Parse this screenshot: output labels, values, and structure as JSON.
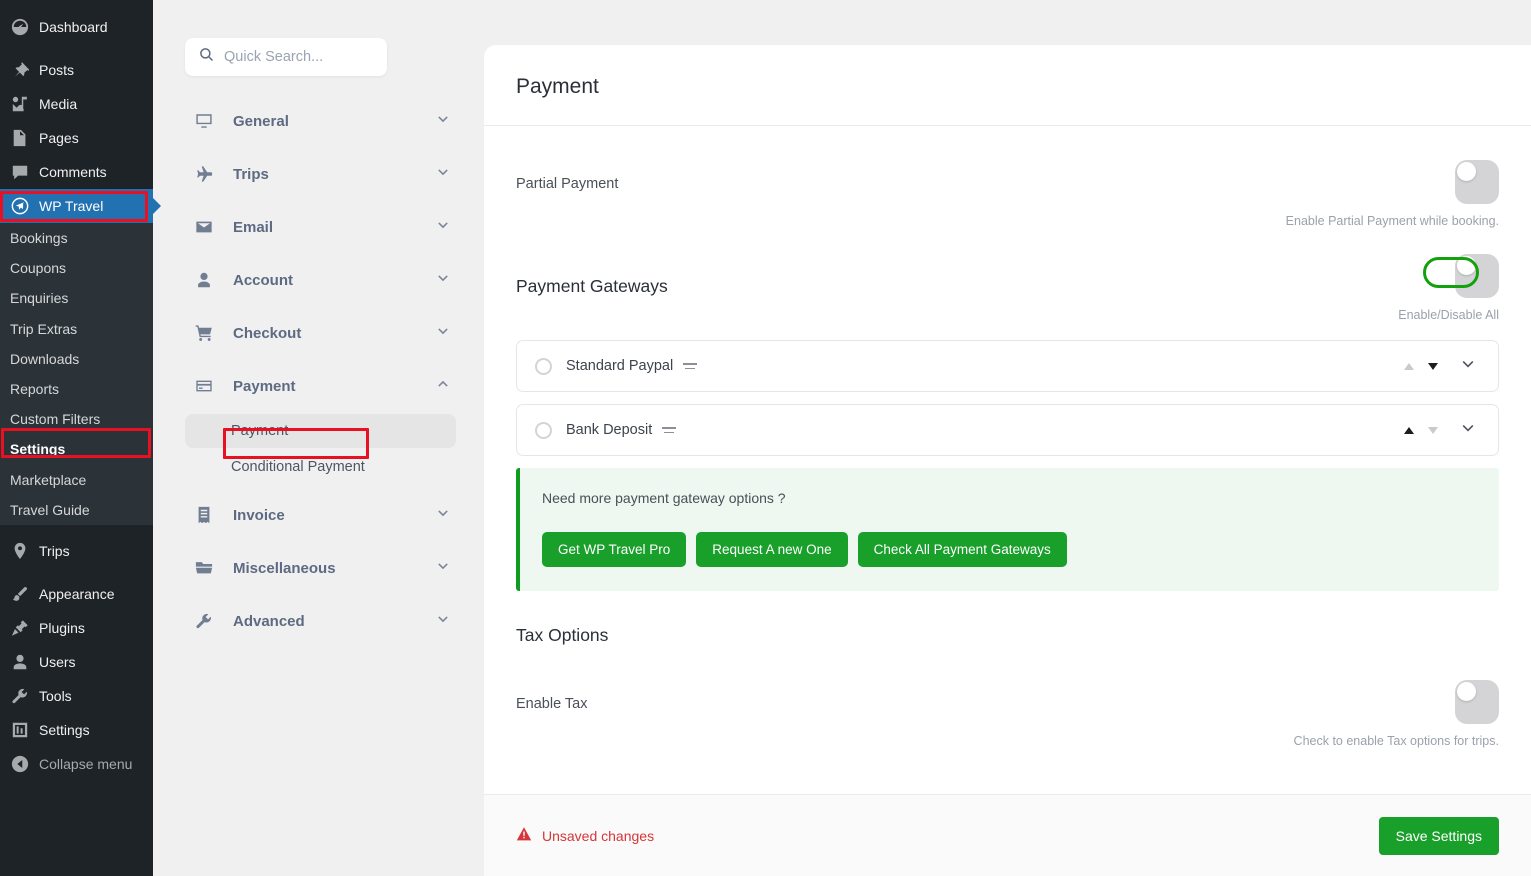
{
  "wp_sidebar": {
    "items": [
      {
        "label": "Dashboard",
        "icon": "dashboard-icon"
      },
      {
        "label": "Posts",
        "icon": "pin-icon"
      },
      {
        "label": "Media",
        "icon": "media-icon"
      },
      {
        "label": "Pages",
        "icon": "pages-icon"
      },
      {
        "label": "Comments",
        "icon": "comments-icon"
      },
      {
        "label": "WP Travel",
        "icon": "wp-travel-icon",
        "current": true
      }
    ],
    "wp_travel_submenu": [
      {
        "label": "Bookings"
      },
      {
        "label": "Coupons"
      },
      {
        "label": "Enquiries"
      },
      {
        "label": "Trip Extras"
      },
      {
        "label": "Downloads"
      },
      {
        "label": "Reports"
      },
      {
        "label": "Custom Filters"
      },
      {
        "label": "Settings",
        "active": true
      },
      {
        "label": "Marketplace"
      },
      {
        "label": "Travel Guide"
      }
    ],
    "bottom_items": [
      {
        "label": "Trips",
        "icon": "location-pin-icon"
      },
      {
        "label": "Appearance",
        "icon": "brush-icon"
      },
      {
        "label": "Plugins",
        "icon": "plug-icon"
      },
      {
        "label": "Users",
        "icon": "user-icon"
      },
      {
        "label": "Tools",
        "icon": "wrench-icon"
      },
      {
        "label": "Settings",
        "icon": "settings-sliders-icon"
      },
      {
        "label": "Collapse menu",
        "icon": "collapse-arrow-icon"
      }
    ]
  },
  "settings_nav": {
    "search": {
      "placeholder": "Quick Search...",
      "value": "",
      "icon": "search-icon"
    },
    "groups": [
      {
        "label": "General",
        "icon": "monitor-icon",
        "expanded": false
      },
      {
        "label": "Trips",
        "icon": "airplane-icon",
        "expanded": false
      },
      {
        "label": "Email",
        "icon": "envelope-icon",
        "expanded": false
      },
      {
        "label": "Account",
        "icon": "person-icon",
        "expanded": false
      },
      {
        "label": "Checkout",
        "icon": "cart-icon",
        "expanded": false
      },
      {
        "label": "Payment",
        "icon": "credit-card-icon",
        "expanded": true,
        "children": [
          {
            "label": "Payment",
            "active": true
          },
          {
            "label": "Conditional Payment",
            "active": false
          }
        ]
      },
      {
        "label": "Invoice",
        "icon": "receipt-icon",
        "expanded": false
      },
      {
        "label": "Miscellaneous",
        "icon": "folder-icon",
        "expanded": false
      },
      {
        "label": "Advanced",
        "icon": "wrench-icon",
        "expanded": false
      }
    ]
  },
  "main": {
    "title": "Payment",
    "partial_payment": {
      "label": "Partial Payment",
      "help": "Enable Partial Payment while booking.",
      "enabled": false
    },
    "payment_gateways": {
      "title": "Payment Gateways",
      "toggle_help": "Enable/Disable All",
      "enabled": false,
      "rows": [
        {
          "name": "Standard Paypal",
          "enabled": false,
          "up_enabled": false,
          "down_enabled": true
        },
        {
          "name": "Bank Deposit",
          "enabled": false,
          "up_enabled": true,
          "down_enabled": false
        }
      ]
    },
    "promo": {
      "text": "Need more payment gateway options ?",
      "buttons": [
        {
          "label": "Get WP Travel Pro"
        },
        {
          "label": "Request A new One"
        },
        {
          "label": "Check All Payment Gateways"
        }
      ]
    },
    "tax_options": {
      "title": "Tax Options",
      "label": "Enable Tax",
      "help": "Check to enable Tax options for trips.",
      "enabled": false
    },
    "footer": {
      "unsaved_label": "Unsaved changes",
      "unsaved_icon": "warning-triangle-icon",
      "save_label": "Save Settings"
    }
  },
  "colors": {
    "wp_sidebar_bg": "#1d2327",
    "wp_current": "#2271b1",
    "green": "#19a02a",
    "promo_bg": "#eef7f0",
    "red_annotation": "#e81123",
    "green_annotation": "#13a10e",
    "danger": "#d63638"
  }
}
